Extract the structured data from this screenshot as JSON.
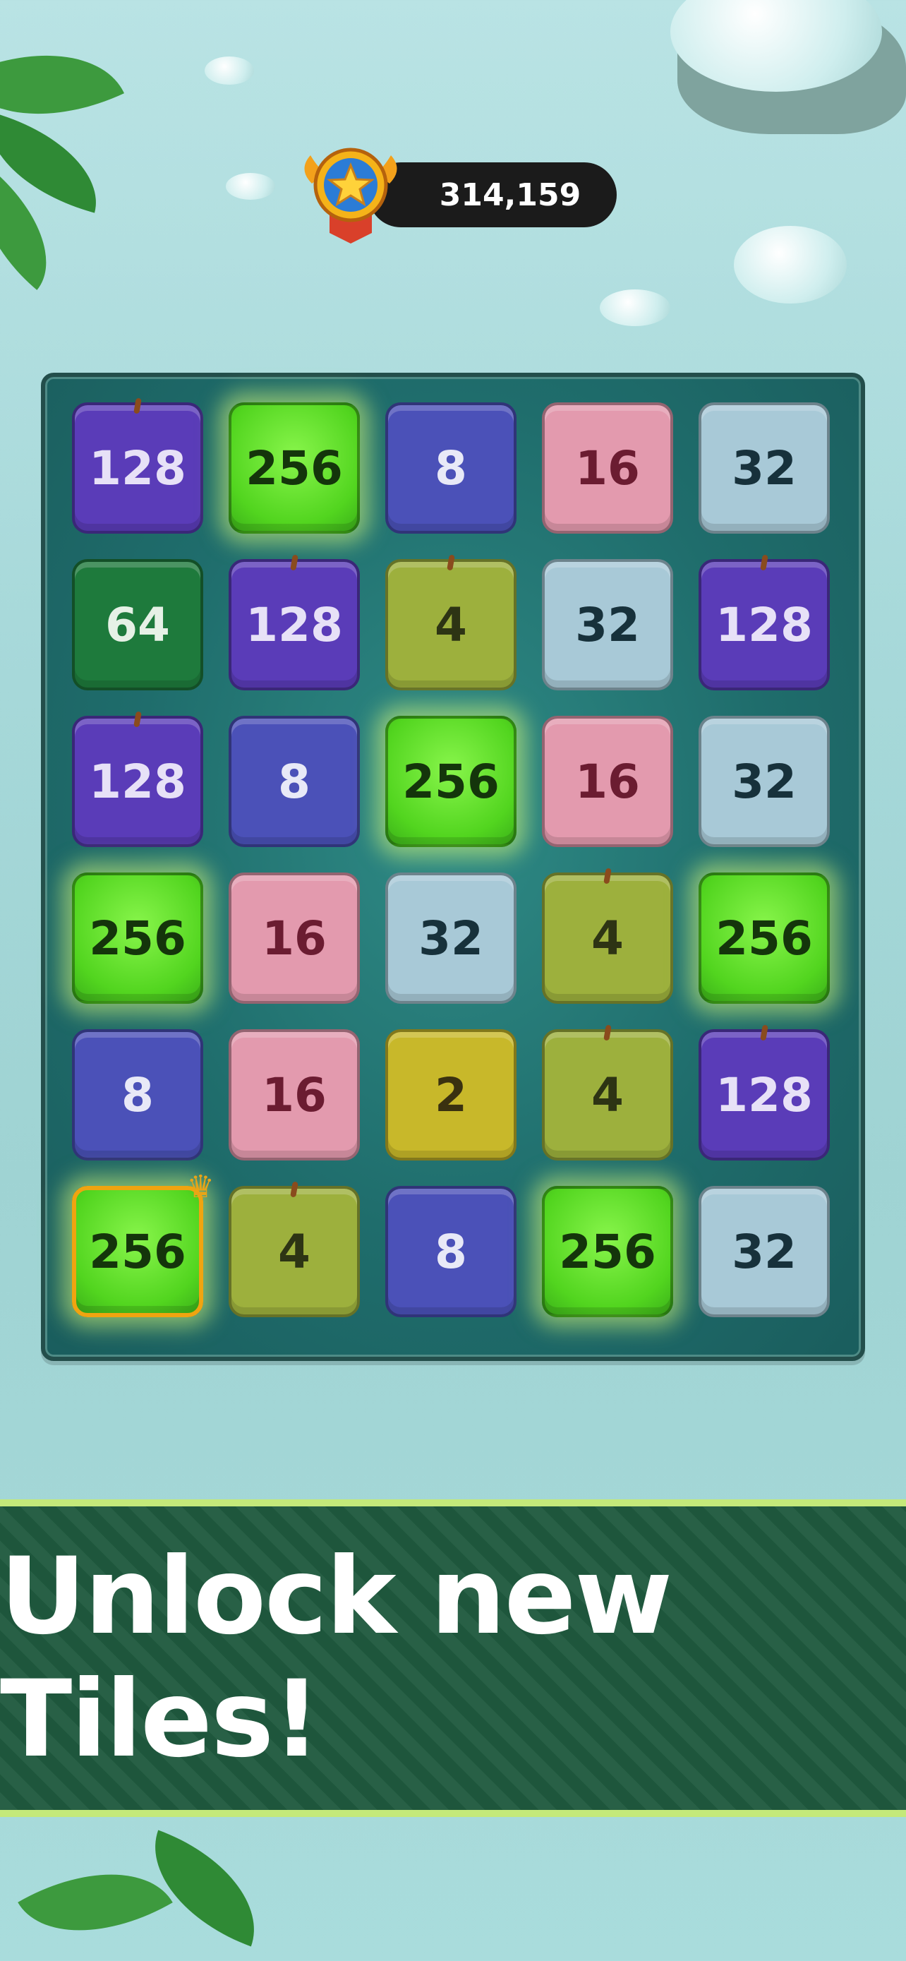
{
  "score": {
    "value": "314,159",
    "medal_icon": "star-medal-icon"
  },
  "board": {
    "rows": [
      [
        "128",
        "256",
        "8",
        "16",
        "32"
      ],
      [
        "64",
        "128",
        "4",
        "32",
        "128"
      ],
      [
        "128",
        "8",
        "256",
        "16",
        "32"
      ],
      [
        "256",
        "16",
        "32",
        "4",
        "256"
      ],
      [
        "8",
        "16",
        "2",
        "4",
        "128"
      ],
      [
        "256",
        "4",
        "8",
        "256",
        "32"
      ]
    ]
  },
  "banner": {
    "text": "Unlock new Tiles!"
  },
  "colors": {
    "tile_2": "#c8b82a",
    "tile_4": "#9db03d",
    "tile_8": "#4b51b8",
    "tile_16": "#e39aae",
    "tile_32": "#a8c9d7",
    "tile_64": "#1e7a3c",
    "tile_128": "#5a3cb8",
    "tile_256": "#52d51f",
    "banner_bg": "#1f5a3e"
  }
}
